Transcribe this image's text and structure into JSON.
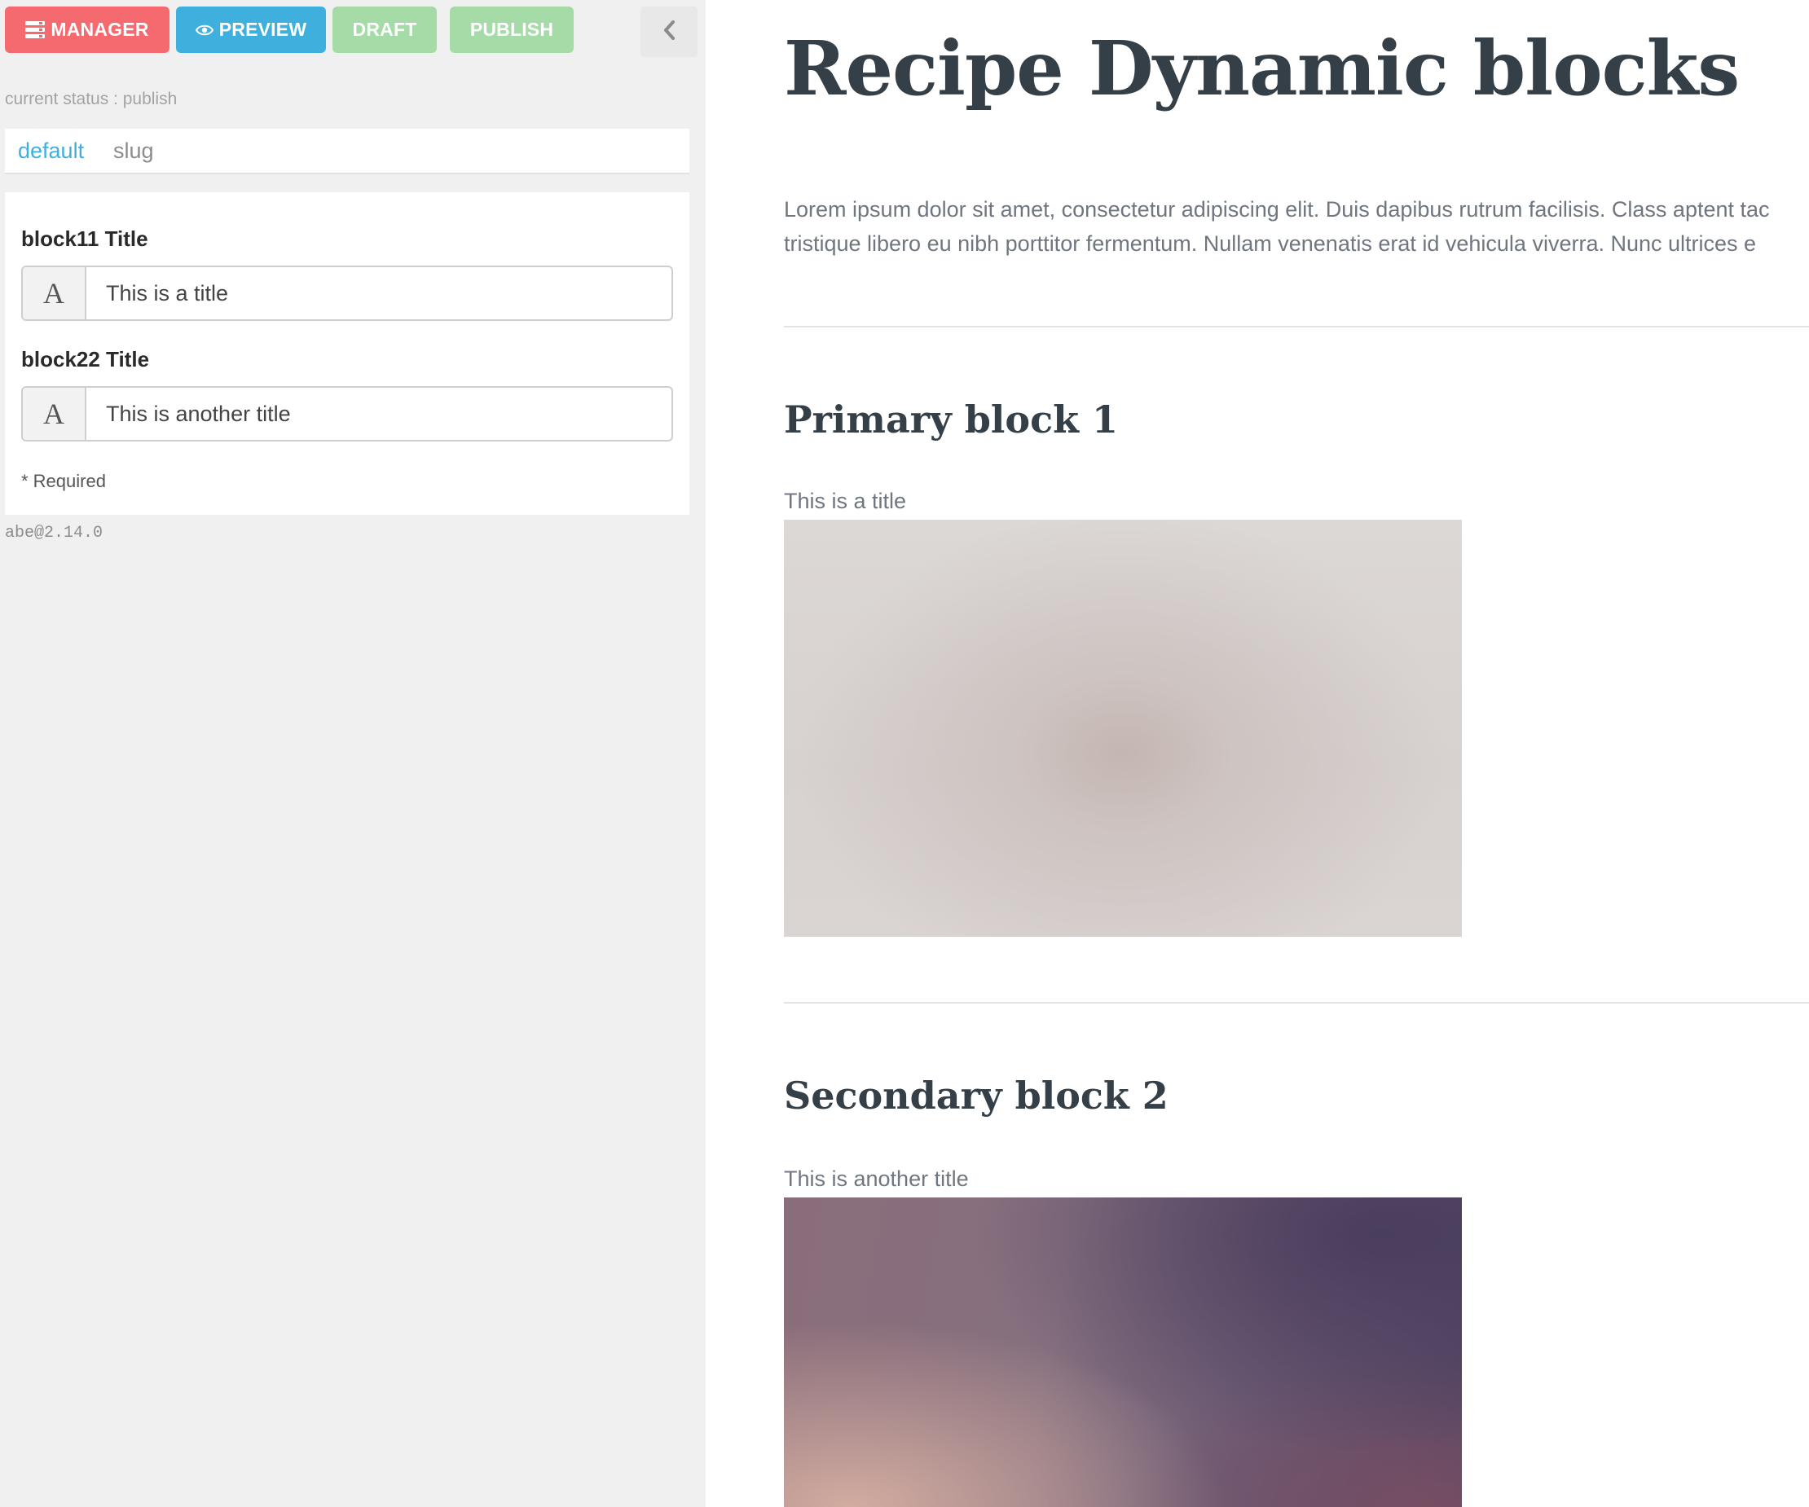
{
  "toolbar": {
    "manager_label": "MANAGER",
    "preview_label": "PREVIEW",
    "draft_label": "DRAFT",
    "publish_label": "PUBLISH",
    "colors": {
      "manager": "#f46a6f",
      "preview": "#3fb0de",
      "draft": "#a5dba7",
      "publish": "#a5dba7"
    }
  },
  "status_text": "current status : publish",
  "tabs": [
    {
      "label": "default",
      "active": true
    },
    {
      "label": "slug",
      "active": false
    }
  ],
  "form": {
    "fields": [
      {
        "label": "block11 Title",
        "addon": "A",
        "value": "This is a title"
      },
      {
        "label": "block22 Title",
        "addon": "A",
        "value": "This is another title"
      }
    ],
    "required_note": "* Required"
  },
  "version": "abe@2.14.0",
  "preview": {
    "title": "Recipe Dynamic blocks",
    "lead_line1": "Lorem ipsum dolor sit amet, consectetur adipiscing elit. Duis dapibus rutrum facilisis. Class aptent tac",
    "lead_line2": "tristique libero eu nibh porttitor fermentum. Nullam venenatis erat id vehicula viverra. Nunc ultrices e",
    "blocks": [
      {
        "heading": "Primary block 1",
        "subtitle": "This is a title"
      },
      {
        "heading": "Secondary block 2",
        "subtitle": "This is another title"
      }
    ]
  }
}
